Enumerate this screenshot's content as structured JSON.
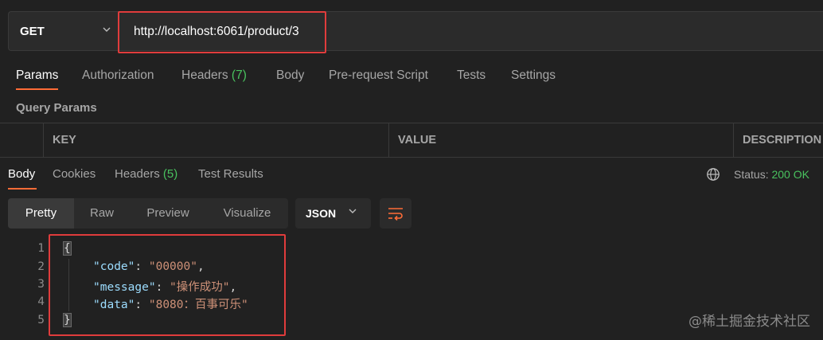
{
  "request": {
    "method": "GET",
    "url": "http://localhost:6061/product/3"
  },
  "request_tabs": [
    {
      "label": "Params"
    },
    {
      "label": "Authorization"
    },
    {
      "label": "Headers",
      "count": "(7)"
    },
    {
      "label": "Body"
    },
    {
      "label": "Pre-request Script"
    },
    {
      "label": "Tests"
    },
    {
      "label": "Settings"
    }
  ],
  "query_params": {
    "title": "Query Params",
    "columns": [
      "KEY",
      "VALUE",
      "DESCRIPTION"
    ]
  },
  "response_tabs": [
    {
      "label": "Body"
    },
    {
      "label": "Cookies"
    },
    {
      "label": "Headers",
      "count": "(5)"
    },
    {
      "label": "Test Results"
    }
  ],
  "status": {
    "label": "Status:",
    "value": "200 OK"
  },
  "view_modes": [
    "Pretty",
    "Raw",
    "Preview",
    "Visualize"
  ],
  "format": "JSON",
  "code_lines": [
    {
      "n": "1"
    },
    {
      "n": "2",
      "key": "\"code\"",
      "value": "\"00000\"",
      "trail": ","
    },
    {
      "n": "3",
      "key": "\"message\"",
      "value": "\"操作成功\"",
      "trail": ","
    },
    {
      "n": "4",
      "key": "\"data\"",
      "value": "\"8080：百事可乐\"",
      "trail": ""
    },
    {
      "n": "5"
    }
  ],
  "braces": {
    "open": "{",
    "close": "}"
  },
  "watermark": "@稀土掘金技术社区",
  "colors": {
    "accent": "#ff6c37",
    "success": "#49c25e",
    "highlight_box": "#e03c3c"
  }
}
